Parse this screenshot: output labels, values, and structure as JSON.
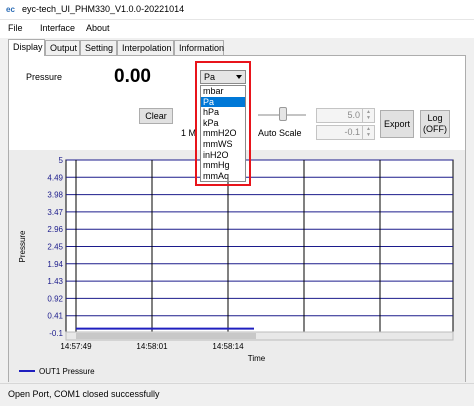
{
  "window": {
    "title": "eyc-tech_UI_PHM330_V1.0.0-20221014",
    "icon": "app-icon"
  },
  "menu": [
    "File",
    "Interface",
    "About"
  ],
  "tabs": [
    "Display",
    "Output",
    "Setting",
    "Interpolation",
    "Information"
  ],
  "active_tab": "Display",
  "display": {
    "pressure_label": "Pressure",
    "pressure_value": "0.00",
    "unit_selected": "Pa",
    "unit_options": [
      "mbar",
      "Pa",
      "hPa",
      "kPa",
      "mmH2O",
      "mmWS",
      "inH2O",
      "mmHg",
      "mmAq"
    ],
    "clear_label": "Clear",
    "interval_partial": "1 M",
    "auto_scale_label": "Auto Scale",
    "upper_value": "5.0",
    "lower_value": "-0.1",
    "export_label": "Export",
    "log_label_line1": "Log",
    "log_label_line2": "(OFF)"
  },
  "colors": {
    "series": "#1f1fbf",
    "highlight_box": "#e8141b",
    "selection": "#0078d7"
  },
  "chart_data": {
    "type": "line",
    "ylabel": "Pressure",
    "xlabel": "Time",
    "y_ticks": [
      "5",
      "4.49",
      "3.98",
      "3.47",
      "2.96",
      "2.45",
      "1.94",
      "1.43",
      "0.92",
      "0.41",
      "-0.1"
    ],
    "x_ticks": [
      "14:57:49",
      "14:58:01",
      "14:58:14"
    ],
    "ylim": [
      -0.1,
      5
    ],
    "grid": true,
    "series": [
      {
        "name": "OUT1 Pressure",
        "x": [
          "14:57:49",
          "14:58:24"
        ],
        "values": [
          0,
          0
        ]
      }
    ],
    "legend_position": "bottom-left"
  },
  "status": {
    "text": "Open Port,   COM1 closed successfully"
  }
}
